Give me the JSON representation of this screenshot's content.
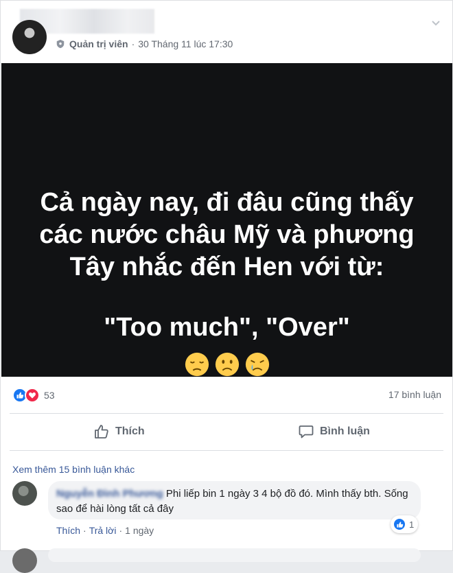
{
  "post": {
    "role": "Quản trị viên",
    "timestamp": "30 Tháng 11 lúc 17:30",
    "image_text": {
      "lines": [
        "Cả ngày nay, đi đâu cũng thấy",
        "các nước châu Mỹ và phương",
        "Tây nhắc đến Hen với từ:"
      ],
      "quote": "\"Too much\", \"Over\""
    },
    "emojis": [
      "pensive-face",
      "frowning-face",
      "crying-face"
    ],
    "reaction_count": "53",
    "comment_count": "17 bình luận",
    "colors": {
      "like": "#1877f2",
      "love": "#f0284a",
      "link": "#385898"
    }
  },
  "actions": {
    "like_label": "Thích",
    "comment_label": "Bình luận"
  },
  "comments": {
    "view_more": "Xem thêm 15 bình luận khác",
    "first": {
      "name": "Nguyễn Đình Phương",
      "text": "Phi liếp bin 1 ngày 3 4 bộ đồ đó. Mình thấy bth. Sống sao để hài lòng tất cả đây",
      "like_label": "Thích",
      "reply_label": "Trả lời",
      "time": "1 ngày",
      "reaction_count": "1"
    }
  }
}
